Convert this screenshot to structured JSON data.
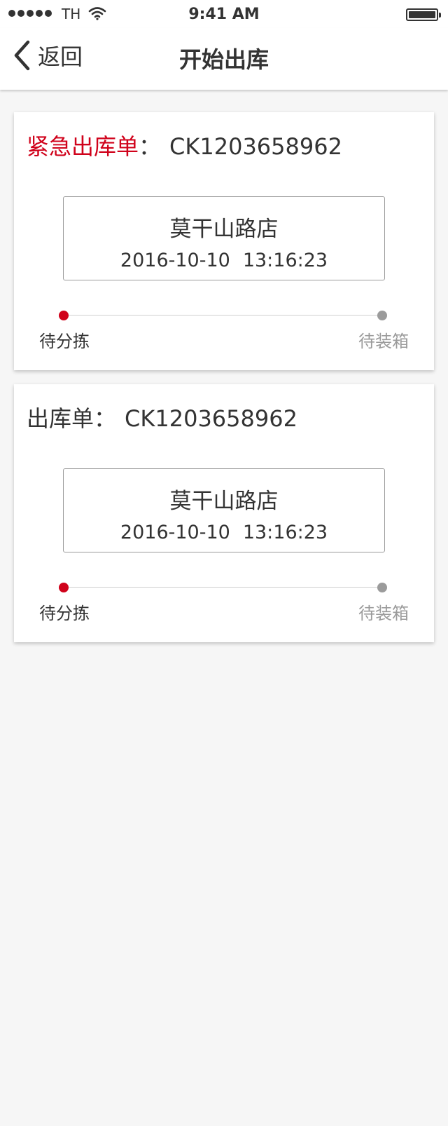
{
  "status_bar": {
    "carrier": "TH",
    "time": "9:41 AM"
  },
  "nav": {
    "back_label": "返回",
    "title": "开始出库"
  },
  "orders": [
    {
      "tag": "紧急出库单",
      "tag_color": "#d0021b",
      "separator": "：",
      "order_no": "CK1203658962",
      "store": "莫干山路店",
      "date": "2016-10-10",
      "time": "13:16:23",
      "step_start": "待分拣",
      "step_end": "待装箱"
    },
    {
      "tag": "出库单",
      "separator": "：",
      "order_no": "CK1203658962",
      "store": "莫干山路店",
      "date": "2016-10-10",
      "time": "13:16:23",
      "step_start": "待分拣",
      "step_end": "待装箱"
    }
  ],
  "colors": {
    "accent": "#d0021b",
    "muted": "#9b9b9b",
    "text": "#333333",
    "background": "#f6f6f6"
  },
  "icons": [
    "signal-dots-icon",
    "wifi-icon",
    "battery-icon",
    "chevron-left-icon"
  ]
}
